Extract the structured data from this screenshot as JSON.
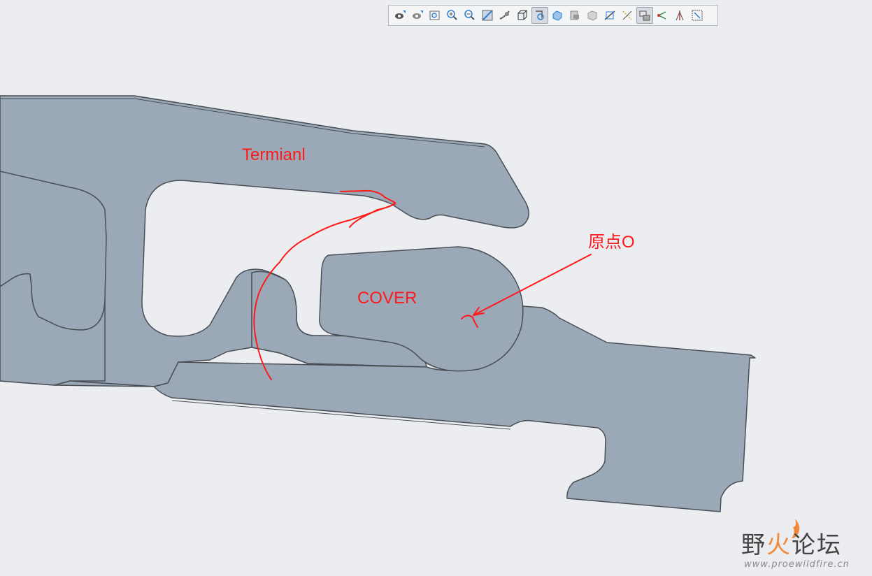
{
  "toolbar": {
    "buttons": [
      {
        "icon": "saved-views-icon",
        "active": false
      },
      {
        "icon": "view-manager-icon",
        "active": false
      },
      {
        "icon": "refit-icon",
        "active": false
      },
      {
        "icon": "zoom-in-icon",
        "active": false
      },
      {
        "icon": "zoom-out-icon",
        "active": false
      },
      {
        "icon": "repaint-icon",
        "active": false
      },
      {
        "icon": "perspective-icon",
        "active": false
      },
      {
        "icon": "display-style-icon",
        "active": false
      },
      {
        "icon": "rotation-center-icon",
        "active": true
      },
      {
        "icon": "named-views-icon",
        "active": false
      },
      {
        "icon": "section-icon",
        "active": false
      },
      {
        "icon": "appearance-icon",
        "active": false
      },
      {
        "icon": "plane-display-icon",
        "active": false
      },
      {
        "icon": "axis-display-icon",
        "active": false
      },
      {
        "icon": "point-display-icon",
        "active": true
      },
      {
        "icon": "csys-display-icon",
        "active": false
      },
      {
        "icon": "spin-center-icon",
        "active": false
      },
      {
        "icon": "annotation-display-icon",
        "active": false
      }
    ]
  },
  "annotations": {
    "terminal_label": "Termianl",
    "cover_label": "COVER",
    "origin_label": "原点O"
  },
  "watermark": {
    "title_part1": "野",
    "title_part2": "火",
    "title_part3": "论坛",
    "url": "www.proewildfire.cn"
  },
  "colors": {
    "part_fill": "#9aa8b8",
    "part_edge": "#4a4f55",
    "annotation": "#ff1a1a",
    "background": "#ebedf0"
  }
}
